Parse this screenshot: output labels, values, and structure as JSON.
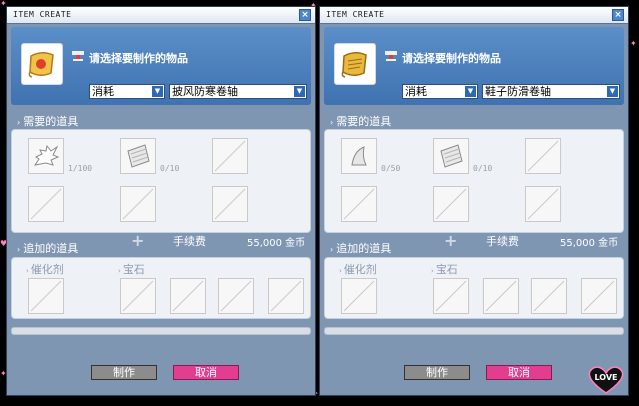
{
  "windows": [
    {
      "title": "ITEM CREATE",
      "header": {
        "title": "请选择要制作的物品",
        "category": "消耗",
        "item": "披风防寒卷轴"
      },
      "required": {
        "label": "需要的道具",
        "counts": [
          "1/100",
          "0/10"
        ]
      },
      "fee": {
        "label": "手续费",
        "value": "55,000 金币"
      },
      "extra": {
        "label": "追加的道具",
        "catalyst_label": "催化剂",
        "gem_label": "宝石"
      },
      "buttons": {
        "make": "制作",
        "cancel": "取消"
      }
    },
    {
      "title": "ITEM CREATE",
      "header": {
        "title": "请选择要制作的物品",
        "category": "消耗",
        "item": "鞋子防滑卷轴"
      },
      "required": {
        "label": "需要的道具",
        "counts": [
          "0/50",
          "0/10"
        ]
      },
      "fee": {
        "label": "手续费",
        "value": "55,000 金币"
      },
      "extra": {
        "label": "追加的道具",
        "catalyst_label": "催化剂",
        "gem_label": "宝石"
      },
      "buttons": {
        "make": "制作",
        "cancel": "取消"
      }
    }
  ],
  "decoration": {
    "love_badge": "LOVE"
  },
  "colors": {
    "window_bg": "#7f96b3",
    "header_blue": "#4a7fbd",
    "cancel_pink": "#e23d8f"
  }
}
